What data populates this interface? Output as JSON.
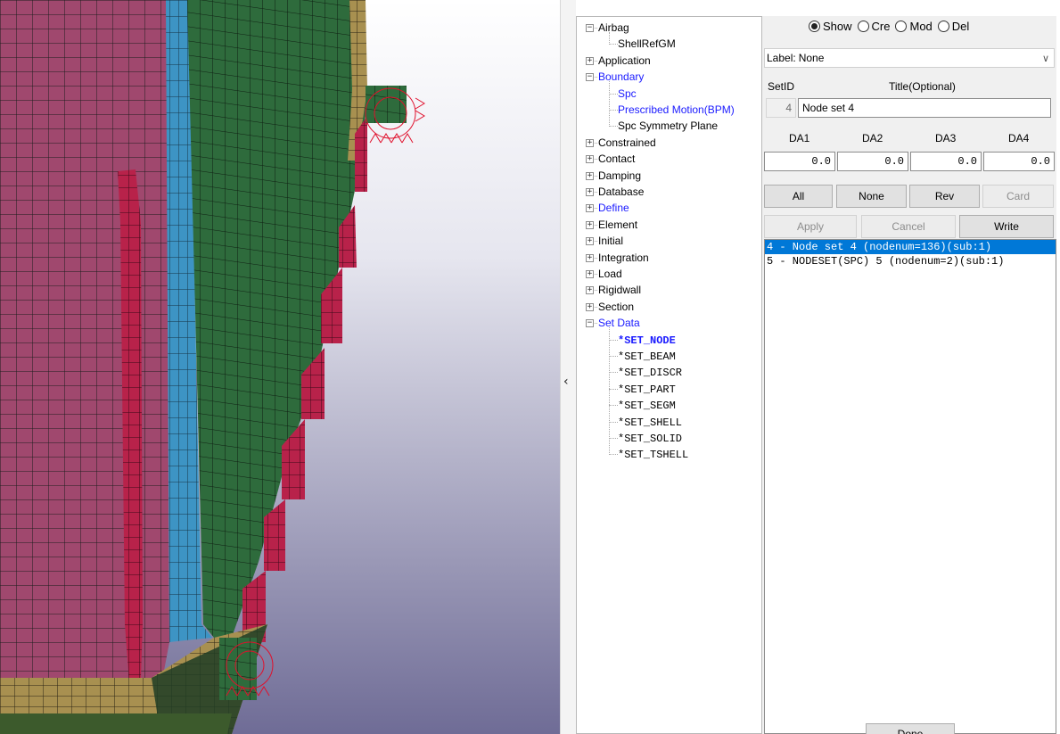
{
  "tree": [
    {
      "label": "Airbag",
      "level": 0,
      "expander": "minus",
      "style": "normal"
    },
    {
      "label": "ShellRefGM",
      "level": 1,
      "expander": null,
      "style": "normal"
    },
    {
      "label": "Application",
      "level": 0,
      "expander": "plus",
      "style": "normal"
    },
    {
      "label": "Boundary",
      "level": 0,
      "expander": "minus",
      "style": "link"
    },
    {
      "label": "Spc",
      "level": 1,
      "expander": null,
      "style": "link"
    },
    {
      "label": "Prescribed Motion(BPM)",
      "level": 1,
      "expander": null,
      "style": "link"
    },
    {
      "label": "Spc Symmetry Plane",
      "level": 1,
      "expander": null,
      "style": "normal"
    },
    {
      "label": "Constrained",
      "level": 0,
      "expander": "plus",
      "style": "normal"
    },
    {
      "label": "Contact",
      "level": 0,
      "expander": "plus",
      "style": "normal"
    },
    {
      "label": "Damping",
      "level": 0,
      "expander": "plus",
      "style": "normal"
    },
    {
      "label": "Database",
      "level": 0,
      "expander": "plus",
      "style": "normal"
    },
    {
      "label": "Define",
      "level": 0,
      "expander": "plus",
      "style": "link"
    },
    {
      "label": "Element",
      "level": 0,
      "expander": "plus",
      "style": "normal"
    },
    {
      "label": "Initial",
      "level": 0,
      "expander": "plus",
      "style": "normal"
    },
    {
      "label": "Integration",
      "level": 0,
      "expander": "plus",
      "style": "normal"
    },
    {
      "label": "Load",
      "level": 0,
      "expander": "plus",
      "style": "normal"
    },
    {
      "label": "Rigidwall",
      "level": 0,
      "expander": "plus",
      "style": "normal"
    },
    {
      "label": "Section",
      "level": 0,
      "expander": "plus",
      "style": "normal"
    },
    {
      "label": "Set Data",
      "level": 0,
      "expander": "minus",
      "style": "link"
    },
    {
      "label": "*SET_NODE",
      "level": 1,
      "expander": null,
      "style": "bold"
    },
    {
      "label": "*SET_BEAM",
      "level": 1,
      "expander": null,
      "style": "mono"
    },
    {
      "label": "*SET_DISCR",
      "level": 1,
      "expander": null,
      "style": "mono"
    },
    {
      "label": "*SET_PART",
      "level": 1,
      "expander": null,
      "style": "mono"
    },
    {
      "label": "*SET_SEGM",
      "level": 1,
      "expander": null,
      "style": "mono"
    },
    {
      "label": "*SET_SHELL",
      "level": 1,
      "expander": null,
      "style": "mono"
    },
    {
      "label": "*SET_SOLID",
      "level": 1,
      "expander": null,
      "style": "mono"
    },
    {
      "label": "*SET_TSHELL",
      "level": 1,
      "expander": null,
      "style": "mono"
    }
  ],
  "mode": {
    "options": [
      "Show",
      "Cre",
      "Mod",
      "Del"
    ],
    "selected": "Show"
  },
  "label_select": {
    "caption": "Label:",
    "value": "None"
  },
  "set_header": {
    "setid_label": "SetID",
    "title_label": "Title(Optional)"
  },
  "set_fields": {
    "setid": "4",
    "title": "Node set 4"
  },
  "da_headers": [
    "DA1",
    "DA2",
    "DA3",
    "DA4"
  ],
  "da_values": [
    "0.0",
    "0.0",
    "0.0",
    "0.0"
  ],
  "buttons_row1": [
    {
      "label": "All",
      "enabled": true
    },
    {
      "label": "None",
      "enabled": true
    },
    {
      "label": "Rev",
      "enabled": true
    },
    {
      "label": "Card",
      "enabled": false
    }
  ],
  "buttons_row2": [
    {
      "label": "Apply",
      "enabled": false
    },
    {
      "label": "Cancel",
      "enabled": false
    },
    {
      "label": "Write",
      "enabled": true
    }
  ],
  "set_list": [
    {
      "text": "4 - Node set 4 (nodenum=136)(sub:1)",
      "selected": true
    },
    {
      "text": "5 - NODESET(SPC) 5 (nodenum=2)(sub:1)",
      "selected": false
    }
  ],
  "done_label": "Done",
  "collapse_glyph": "‹",
  "colors": {
    "selection": "#0078d7",
    "link": "#1a1aff",
    "mesh_magenta": "#a0486e",
    "mesh_green": "#2e6b3c",
    "mesh_blue": "#3d94c4",
    "mesh_red": "#b8224a",
    "mesh_tan": "#a89050"
  }
}
